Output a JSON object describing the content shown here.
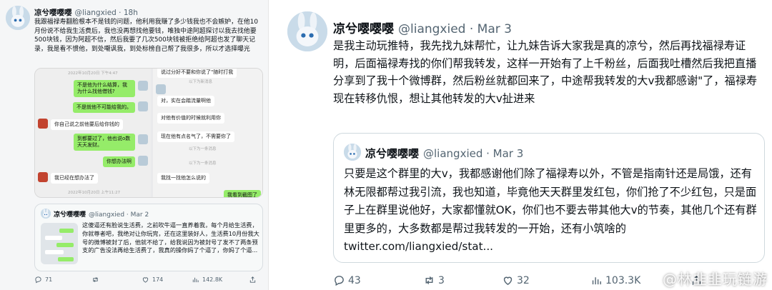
{
  "left_tweet": {
    "author_name": "凉兮嘤嘤嘤",
    "handle_time": "@liangxied · 18h",
    "text": "我跟福禄寿翻脸根本不是钱的问题，他利用我赚了多少钱我也不会嫉妒，在他10月份说不给我生活费后，我也没再想找他要钱，唯独中途阿超探讨以我去找他要500块钱，因为阿超不信，然后我要了几次500块钱被拒绝给阿超也发了聊天记录，我是看不惯他，到处嘲讽我，到处标榜自己帮了我很多，所以才选择曝光",
    "chat": {
      "top_timestamp": "2022年10月20日 下午4:47",
      "left_messages": [
        {
          "text": "不是他为什么结算，我为什么找他借钱?",
          "style": "green"
        },
        {
          "text": "不是就他不可能给我的。",
          "style": "green"
        },
        {
          "text": "你自己说之前他要后给你钱的",
          "style": "white"
        },
        {
          "text": "到都要过了，他也说o数天天发财。",
          "style": "green"
        },
        {
          "text": "你想办法啊",
          "style": "green"
        },
        {
          "text": "我已经在想办法了",
          "style": "white"
        }
      ],
      "bottom_timestamp": "2022年10月20日 上午11:27",
      "right_messages": [
        {
          "text": "说过分好不要和你说了\"随时打我",
          "style": "white"
        },
        {
          "text": "对，实在会踏流量啊他",
          "style": "white"
        },
        {
          "text": "对他有价值的时候就利用你",
          "style": "white"
        },
        {
          "text": "现在他有点名气了，不需要你了",
          "style": "white"
        },
        {
          "text": "我找一找他怎么说的",
          "style": "white"
        },
        {
          "text": "我看到截图了",
          "style": "green"
        }
      ],
      "right_timestamps": [
        "以下为新消息",
        "以下为一条消息",
        "以下为一条消息"
      ]
    },
    "quote": {
      "author_name": "凉兮嘤嘤嘤",
      "handle_time": "@liangxied · Mar 2",
      "text": "这傻逼还有脸说生活费，之前吹牛逼一直养着我，每个月给生活费，你就尊者吧，我绝对让你玩完，还在这里装好人，生活费10月份我大号的微博被封了后，他就不给了，给我说因为被封号了发不了两条预支的广告没法再给生活费了，我真的操你妈了个逼了，你妈了个逼..."
    },
    "actions": {
      "replies": "71",
      "retweets": "",
      "likes": "174",
      "views": "142.8K"
    }
  },
  "right_tweet": {
    "author_name": "凉兮嘤嘤嘤",
    "handle_time": "@liangxied · Mar 3",
    "text": "是我主动玩推特，我先找九妹帮忙，让九妹告诉大家我是真的凉兮，然后再找福禄寿证明，后面福禄寿找的你们帮我转发，这样一开始有了上千粉丝，后面我吐槽然后我把直播分享到了我十个微博群，然后粉丝就都回来了，中途帮我转发的大v我都感谢\"了，福禄寿现在转移仇恨，想让其他转发的大v扯进来",
    "quote": {
      "author_name": "凉兮嘤嘤嘤",
      "handle_time": "@liangxied · Mar 3",
      "text": "只要是这个群里的大v，我都感谢他们除了福禄寿以外，不管是指南针还是局饿，还有林无限都帮过我引流，我也知道，毕竟他天天群里发红包，你们抢了不少红包，只是面子上在群里说他好，大家都懂就OK，你们也不要去带其他大v的节奏，其他几个还有群里更多的，大多数都是帮过我转发的一开始，还有小筑啥的 twitter.com/liangxied/stat..."
    },
    "actions": {
      "replies": "43",
      "retweets": "3",
      "likes": "32",
      "views": "103.3K"
    }
  },
  "watermark": "@林韭韭玩链游",
  "colors": {
    "text": "#0f1419",
    "muted": "#536471",
    "border": "#cfd9de",
    "wechat_green": "#95ec69"
  }
}
